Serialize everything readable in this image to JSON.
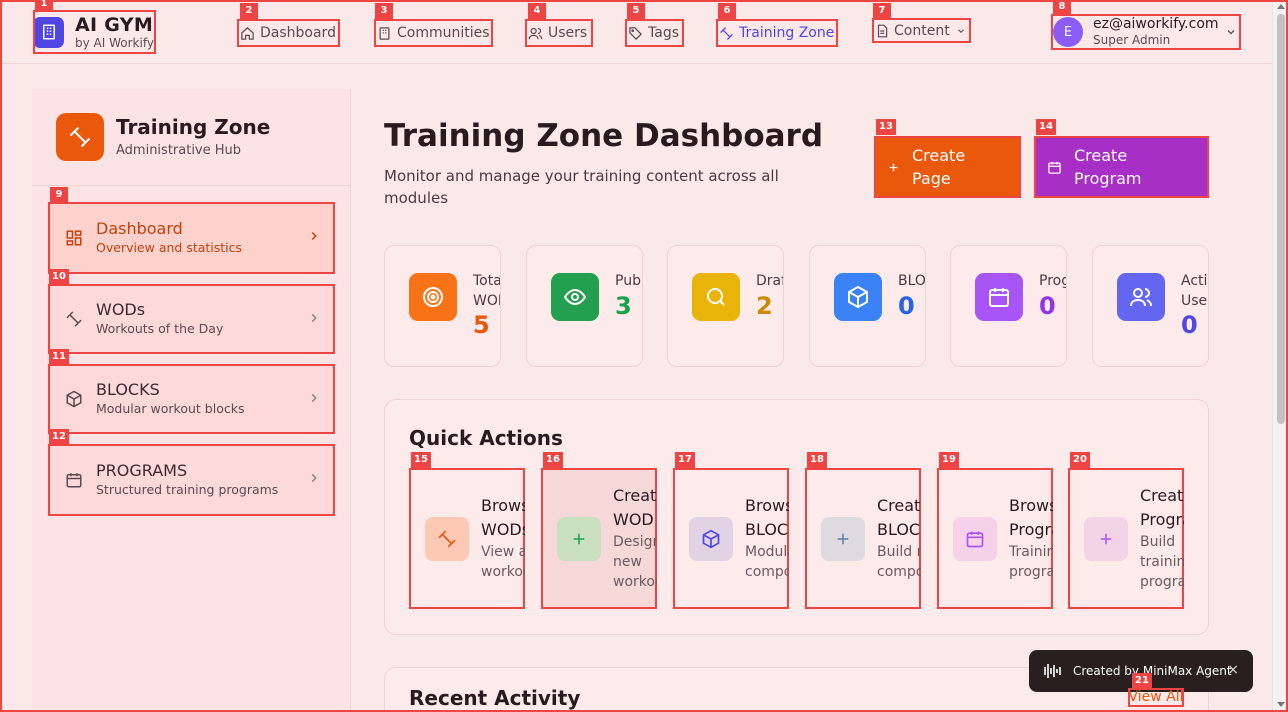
{
  "brand": {
    "title": "AI GYM",
    "subtitle": "by AI Workify"
  },
  "nav": {
    "dashboard": "Dashboard",
    "communities": "Communities",
    "users": "Users",
    "tags": "Tags",
    "training_zone": "Training Zone",
    "content": "Content"
  },
  "user": {
    "initial": "E",
    "email": "ez@aiworkify.com",
    "role": "Super Admin"
  },
  "sidebar": {
    "title": "Training Zone",
    "subtitle": "Administrative Hub",
    "items": [
      {
        "label": "Dashboard",
        "desc": "Overview and statistics"
      },
      {
        "label": "WODs",
        "desc": "Workouts of the Day"
      },
      {
        "label": "BLOCKS",
        "desc": "Modular workout blocks"
      },
      {
        "label": "PROGRAMS",
        "desc": "Structured training programs"
      }
    ]
  },
  "main": {
    "title": "Training Zone Dashboard",
    "subtitle": "Monitor and manage your training content across all modules",
    "create_page": "Create Page",
    "create_program": "Create Program"
  },
  "stats": [
    {
      "label": "Total WODs",
      "value": "5",
      "color": "#ea580c"
    },
    {
      "label": "Published",
      "value": "3",
      "color": "#16a34a"
    },
    {
      "label": "Drafts",
      "value": "2",
      "color": "#ca8a04"
    },
    {
      "label": "BLOCKS",
      "value": "0",
      "color": "#2563eb"
    },
    {
      "label": "Programs",
      "value": "0",
      "color": "#9333ea"
    },
    {
      "label": "Active Users",
      "value": "0",
      "color": "#4f46e5"
    }
  ],
  "quick_actions": {
    "title": "Quick Actions",
    "items": [
      {
        "title": "Browse WODs",
        "desc": "View all workouts"
      },
      {
        "title": "Create WOD",
        "desc": "Design new workout"
      },
      {
        "title": "Browse BLOCKS",
        "desc": "Modular components"
      },
      {
        "title": "Create BLOCK",
        "desc": "Build new component"
      },
      {
        "title": "Browse Programs",
        "desc": "Training programs"
      },
      {
        "title": "Create Program",
        "desc": "Build training program"
      }
    ]
  },
  "recent": {
    "title": "Recent Activity",
    "view_all": "View All"
  },
  "toast": {
    "text": "Created by MiniMax Agent",
    "close": "×"
  },
  "marks": [
    "1",
    "2",
    "3",
    "4",
    "5",
    "6",
    "7",
    "8",
    "9",
    "10",
    "11",
    "12",
    "13",
    "14",
    "15",
    "16",
    "17",
    "18",
    "19",
    "20",
    "21"
  ]
}
